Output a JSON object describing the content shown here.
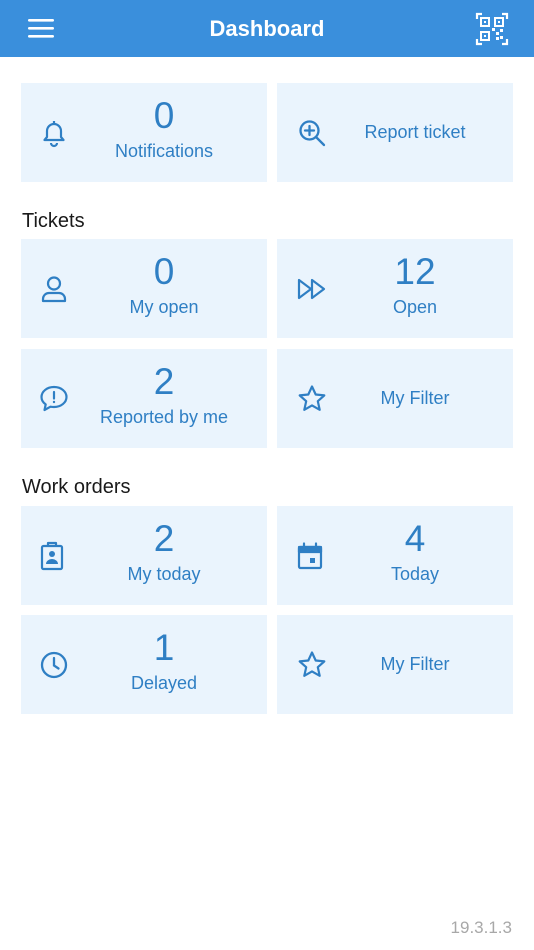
{
  "header": {
    "title": "Dashboard",
    "menu_icon": "hamburger-menu-icon",
    "qr_icon": "qr-code-icon",
    "color": "#3a8fdc"
  },
  "top": {
    "notifications": {
      "count": "0",
      "label": "Notifications",
      "icon": "bell-icon"
    },
    "report_ticket": {
      "label": "Report ticket",
      "icon": "zoom-plus-icon"
    }
  },
  "tickets": {
    "heading": "Tickets",
    "my_open": {
      "count": "0",
      "label": "My open",
      "icon": "user-icon"
    },
    "open": {
      "count": "12",
      "label": "Open",
      "icon": "fast-forward-icon"
    },
    "reported_by_me": {
      "count": "2",
      "label": "Reported by me",
      "icon": "speech-bubble-alert-icon"
    },
    "my_filter": {
      "label": "My Filter",
      "icon": "star-icon"
    }
  },
  "work_orders": {
    "heading": "Work orders",
    "my_today": {
      "count": "2",
      "label": "My today",
      "icon": "clipboard-badge-icon"
    },
    "today": {
      "count": "4",
      "label": "Today",
      "icon": "calendar-icon"
    },
    "delayed": {
      "count": "1",
      "label": "Delayed",
      "icon": "clock-icon"
    },
    "my_filter": {
      "label": "My Filter",
      "icon": "star-icon"
    }
  },
  "version": "19.3.1.3",
  "colors": {
    "tile_bg": "#eaf4fd",
    "accent": "#2f7fc4"
  }
}
